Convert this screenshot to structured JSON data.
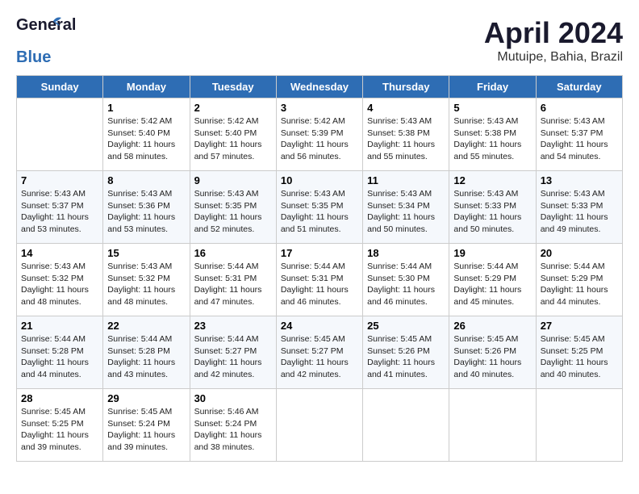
{
  "logo": {
    "general": "General",
    "blue": "Blue"
  },
  "title": "April 2024",
  "subtitle": "Mutuipe, Bahia, Brazil",
  "days": [
    "Sunday",
    "Monday",
    "Tuesday",
    "Wednesday",
    "Thursday",
    "Friday",
    "Saturday"
  ],
  "weeks": [
    [
      {
        "date": "",
        "info": ""
      },
      {
        "date": "1",
        "info": "Sunrise: 5:42 AM\nSunset: 5:40 PM\nDaylight: 11 hours\nand 58 minutes."
      },
      {
        "date": "2",
        "info": "Sunrise: 5:42 AM\nSunset: 5:40 PM\nDaylight: 11 hours\nand 57 minutes."
      },
      {
        "date": "3",
        "info": "Sunrise: 5:42 AM\nSunset: 5:39 PM\nDaylight: 11 hours\nand 56 minutes."
      },
      {
        "date": "4",
        "info": "Sunrise: 5:43 AM\nSunset: 5:38 PM\nDaylight: 11 hours\nand 55 minutes."
      },
      {
        "date": "5",
        "info": "Sunrise: 5:43 AM\nSunset: 5:38 PM\nDaylight: 11 hours\nand 55 minutes."
      },
      {
        "date": "6",
        "info": "Sunrise: 5:43 AM\nSunset: 5:37 PM\nDaylight: 11 hours\nand 54 minutes."
      }
    ],
    [
      {
        "date": "7",
        "info": "Sunrise: 5:43 AM\nSunset: 5:37 PM\nDaylight: 11 hours\nand 53 minutes."
      },
      {
        "date": "8",
        "info": "Sunrise: 5:43 AM\nSunset: 5:36 PM\nDaylight: 11 hours\nand 53 minutes."
      },
      {
        "date": "9",
        "info": "Sunrise: 5:43 AM\nSunset: 5:35 PM\nDaylight: 11 hours\nand 52 minutes."
      },
      {
        "date": "10",
        "info": "Sunrise: 5:43 AM\nSunset: 5:35 PM\nDaylight: 11 hours\nand 51 minutes."
      },
      {
        "date": "11",
        "info": "Sunrise: 5:43 AM\nSunset: 5:34 PM\nDaylight: 11 hours\nand 50 minutes."
      },
      {
        "date": "12",
        "info": "Sunrise: 5:43 AM\nSunset: 5:33 PM\nDaylight: 11 hours\nand 50 minutes."
      },
      {
        "date": "13",
        "info": "Sunrise: 5:43 AM\nSunset: 5:33 PM\nDaylight: 11 hours\nand 49 minutes."
      }
    ],
    [
      {
        "date": "14",
        "info": "Sunrise: 5:43 AM\nSunset: 5:32 PM\nDaylight: 11 hours\nand 48 minutes."
      },
      {
        "date": "15",
        "info": "Sunrise: 5:43 AM\nSunset: 5:32 PM\nDaylight: 11 hours\nand 48 minutes."
      },
      {
        "date": "16",
        "info": "Sunrise: 5:44 AM\nSunset: 5:31 PM\nDaylight: 11 hours\nand 47 minutes."
      },
      {
        "date": "17",
        "info": "Sunrise: 5:44 AM\nSunset: 5:31 PM\nDaylight: 11 hours\nand 46 minutes."
      },
      {
        "date": "18",
        "info": "Sunrise: 5:44 AM\nSunset: 5:30 PM\nDaylight: 11 hours\nand 46 minutes."
      },
      {
        "date": "19",
        "info": "Sunrise: 5:44 AM\nSunset: 5:29 PM\nDaylight: 11 hours\nand 45 minutes."
      },
      {
        "date": "20",
        "info": "Sunrise: 5:44 AM\nSunset: 5:29 PM\nDaylight: 11 hours\nand 44 minutes."
      }
    ],
    [
      {
        "date": "21",
        "info": "Sunrise: 5:44 AM\nSunset: 5:28 PM\nDaylight: 11 hours\nand 44 minutes."
      },
      {
        "date": "22",
        "info": "Sunrise: 5:44 AM\nSunset: 5:28 PM\nDaylight: 11 hours\nand 43 minutes."
      },
      {
        "date": "23",
        "info": "Sunrise: 5:44 AM\nSunset: 5:27 PM\nDaylight: 11 hours\nand 42 minutes."
      },
      {
        "date": "24",
        "info": "Sunrise: 5:45 AM\nSunset: 5:27 PM\nDaylight: 11 hours\nand 42 minutes."
      },
      {
        "date": "25",
        "info": "Sunrise: 5:45 AM\nSunset: 5:26 PM\nDaylight: 11 hours\nand 41 minutes."
      },
      {
        "date": "26",
        "info": "Sunrise: 5:45 AM\nSunset: 5:26 PM\nDaylight: 11 hours\nand 40 minutes."
      },
      {
        "date": "27",
        "info": "Sunrise: 5:45 AM\nSunset: 5:25 PM\nDaylight: 11 hours\nand 40 minutes."
      }
    ],
    [
      {
        "date": "28",
        "info": "Sunrise: 5:45 AM\nSunset: 5:25 PM\nDaylight: 11 hours\nand 39 minutes."
      },
      {
        "date": "29",
        "info": "Sunrise: 5:45 AM\nSunset: 5:24 PM\nDaylight: 11 hours\nand 39 minutes."
      },
      {
        "date": "30",
        "info": "Sunrise: 5:46 AM\nSunset: 5:24 PM\nDaylight: 11 hours\nand 38 minutes."
      },
      {
        "date": "",
        "info": ""
      },
      {
        "date": "",
        "info": ""
      },
      {
        "date": "",
        "info": ""
      },
      {
        "date": "",
        "info": ""
      }
    ]
  ]
}
